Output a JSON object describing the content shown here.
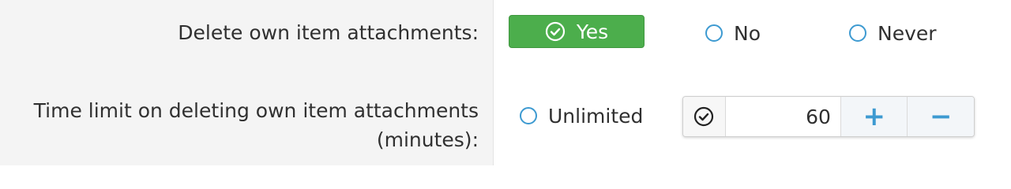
{
  "form": {
    "delete_attachments": {
      "label": "Delete own item attachments:",
      "options": {
        "yes": "Yes",
        "no": "No",
        "never": "Never"
      },
      "selected": "Yes"
    },
    "time_limit": {
      "label_line1": "Time limit on deleting own item attachments",
      "label_line2": "(minutes):",
      "unlimited_label": "Unlimited",
      "value": "60",
      "plus": "+",
      "minus": "−"
    }
  },
  "colors": {
    "selected_green": "#4cae4c",
    "radio_blue": "#3d9ad1",
    "label_pane": "#f4f4f4"
  },
  "icons": {
    "yes": "check-circle-icon",
    "stepper_check": "check-circle-icon",
    "radio": "radio-circle-icon"
  }
}
